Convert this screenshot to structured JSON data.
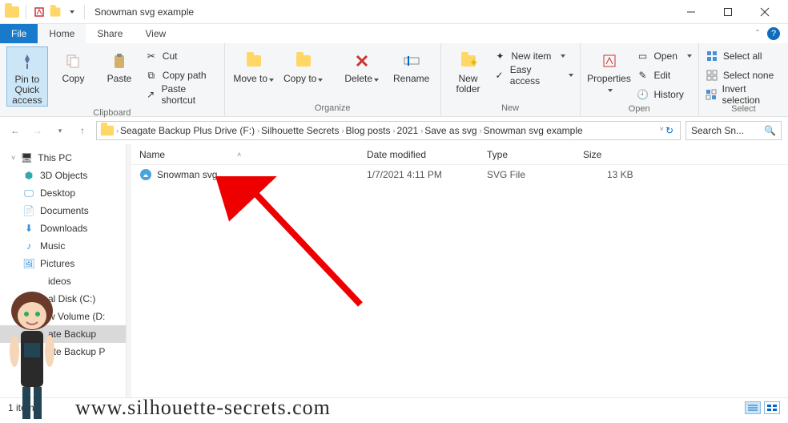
{
  "title": "Snowman svg example",
  "ribbon_tabs": {
    "file": "File",
    "home": "Home",
    "share": "Share",
    "view": "View"
  },
  "ribbon": {
    "clipboard": {
      "label": "Clipboard",
      "pin": "Pin to Quick access",
      "copy": "Copy",
      "paste": "Paste",
      "cut": "Cut",
      "copy_path": "Copy path",
      "paste_shortcut": "Paste shortcut"
    },
    "organize": {
      "label": "Organize",
      "move": "Move to",
      "copy": "Copy to",
      "delete": "Delete",
      "rename": "Rename"
    },
    "new": {
      "label": "New",
      "folder": "New folder",
      "item": "New item",
      "easy": "Easy access"
    },
    "open": {
      "label": "Open",
      "properties": "Properties",
      "open": "Open",
      "edit": "Edit",
      "history": "History"
    },
    "select": {
      "label": "Select",
      "all": "Select all",
      "none": "Select none",
      "invert": "Invert selection"
    }
  },
  "breadcrumbs": [
    "Seagate Backup Plus Drive (F:)",
    "Silhouette Secrets",
    "Blog posts",
    "2021",
    "Save as svg",
    "Snowman svg example"
  ],
  "search_placeholder": "Search Sn...",
  "columns": {
    "name": "Name",
    "date": "Date modified",
    "type": "Type",
    "size": "Size"
  },
  "nav": {
    "this_pc": "This PC",
    "items": [
      "3D Objects",
      "Desktop",
      "Documents",
      "Downloads",
      "Music",
      "Pictures",
      "Videos",
      "Local Disk (C:)",
      "New Volume (D:)",
      "Seagate Backup Plus",
      "Seagate Backup Plus"
    ],
    "truncated": [
      "ideos",
      "al Disk (C:)",
      "w Volume (D:",
      "ate Backup",
      "ate Backup P"
    ]
  },
  "file": {
    "name": "Snowman svg",
    "date": "1/7/2021 4:11 PM",
    "type": "SVG File",
    "size": "13 KB"
  },
  "status": "1 item",
  "watermark": "www.silhouette-secrets.com"
}
